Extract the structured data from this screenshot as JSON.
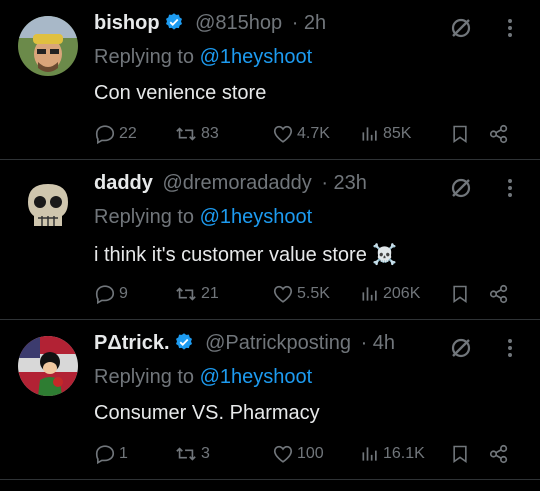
{
  "tweets": [
    {
      "name": "bishop",
      "verified": true,
      "handle": "@815hop",
      "time": "· 2h",
      "reply_prefix": "Replying to",
      "reply_to": "@1heyshoot",
      "text": "Con venience store",
      "replies": "22",
      "retweets": "83",
      "likes": "4.7K",
      "views": "85K"
    },
    {
      "name": "daddy",
      "verified": false,
      "handle": "@dremoradaddy",
      "time": "· 23h",
      "reply_prefix": "Replying to",
      "reply_to": "@1heyshoot",
      "text": "i think it's customer value store ☠️",
      "replies": "9",
      "retweets": "21",
      "likes": "5.5K",
      "views": "206K"
    },
    {
      "name": "PΔtrick.",
      "verified": true,
      "handle": "@Patrickposting",
      "time": "· 4h",
      "reply_prefix": "Replying to",
      "reply_to": "@1heyshoot",
      "text": "Consumer VS. Pharmacy",
      "replies": "1",
      "retweets": "3",
      "likes": "100",
      "views": "16.1K"
    }
  ],
  "colors": {
    "background": "#000000",
    "text": "#e7e9ea",
    "muted": "#71767b",
    "link": "#1d9bf0",
    "verified": "#1d9bf0",
    "divider": "#2f3336"
  },
  "icons": [
    "verified-badge-icon",
    "grok-icon",
    "more-icon",
    "reply-icon",
    "retweet-icon",
    "like-icon",
    "views-icon",
    "bookmark-icon",
    "share-icon"
  ]
}
